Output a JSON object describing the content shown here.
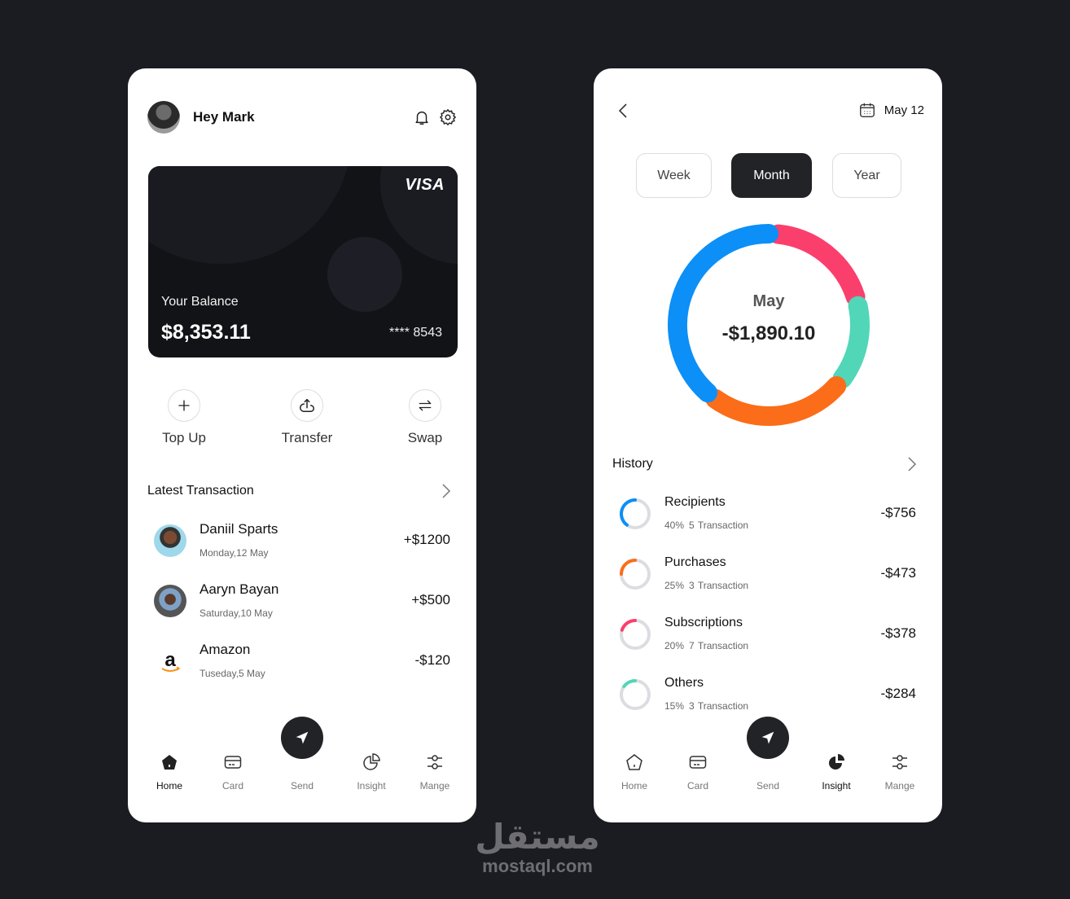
{
  "home": {
    "greeting": "Hey Mark",
    "card": {
      "brand": "VISA",
      "balance_label": "Your Balance",
      "balance": "$8,353.11",
      "masked_number": "**** 8543"
    },
    "actions": [
      {
        "label": "Top Up",
        "icon": "plus-icon"
      },
      {
        "label": "Transfer",
        "icon": "upload-cloud-icon"
      },
      {
        "label": "Swap",
        "icon": "swap-arrows-icon"
      }
    ],
    "latest_title": "Latest Transaction",
    "transactions": [
      {
        "name": "Daniil Sparts",
        "date": "Monday,12 May",
        "amount": "+$1200",
        "avatar": "person-avatar"
      },
      {
        "name": "Aaryn Bayan",
        "date": "Saturday,10 May",
        "amount": "+$500",
        "avatar": "person-avatar"
      },
      {
        "name": "Amazon",
        "date": "Tuseday,5 May",
        "amount": "-$120",
        "avatar": "amazon-logo"
      }
    ],
    "nav": [
      {
        "label": "Home",
        "icon": "home-icon",
        "active": true
      },
      {
        "label": "Card",
        "icon": "card-icon",
        "active": false
      },
      {
        "label": "Send",
        "icon": "send-icon",
        "active": false
      },
      {
        "label": "Insight",
        "icon": "pie-chart-icon",
        "active": false
      },
      {
        "label": "Mange",
        "icon": "sliders-icon",
        "active": false
      }
    ]
  },
  "insight": {
    "date": "May 12",
    "periods": [
      {
        "label": "Week",
        "active": false
      },
      {
        "label": "Month",
        "active": true
      },
      {
        "label": "Year",
        "active": false
      }
    ],
    "donut_month": "May",
    "donut_total": "-$1,890.10",
    "history_title": "History",
    "history": [
      {
        "name": "Recipients",
        "percent": "40%",
        "percent_value": 40,
        "transactions": "5 Transaction",
        "amount": "-$756",
        "color": "#0c8ff7"
      },
      {
        "name": "Purchases",
        "percent": "25%",
        "percent_value": 25,
        "transactions": "3 Transaction",
        "amount": "-$473",
        "color": "#fb6d19"
      },
      {
        "name": "Subscriptions",
        "percent": "20%",
        "percent_value": 20,
        "transactions": "7 Transaction",
        "amount": "-$378",
        "color": "#fb3f6c"
      },
      {
        "name": "Others",
        "percent": "15%",
        "percent_value": 15,
        "transactions": "3 Transaction",
        "amount": "-$284",
        "color": "#51d6b8"
      }
    ],
    "nav": [
      {
        "label": "Home",
        "icon": "home-icon",
        "active": false
      },
      {
        "label": "Card",
        "icon": "card-icon",
        "active": false
      },
      {
        "label": "Send",
        "icon": "send-icon",
        "active": false
      },
      {
        "label": "Insight",
        "icon": "pie-chart-icon",
        "active": true
      },
      {
        "label": "Mange",
        "icon": "sliders-icon",
        "active": false
      }
    ]
  },
  "chart_data": {
    "type": "pie",
    "title": "May",
    "center_value": "-$1,890.10",
    "categories": [
      "Recipients",
      "Subscriptions",
      "Others",
      "Purchases"
    ],
    "values": [
      40,
      20,
      15,
      25
    ],
    "colors": [
      "#0c8ff7",
      "#fb3f6c",
      "#51d6b8",
      "#fb6d19"
    ]
  },
  "colors": {
    "background": "#1b1c21",
    "dark": "#222327",
    "recipients": "#0c8ff7",
    "purchases": "#fb6d19",
    "subscriptions": "#fb3f6c",
    "others": "#51d6b8"
  },
  "watermark": {
    "arabic": "مستقل",
    "latin": "mostaql.com"
  }
}
